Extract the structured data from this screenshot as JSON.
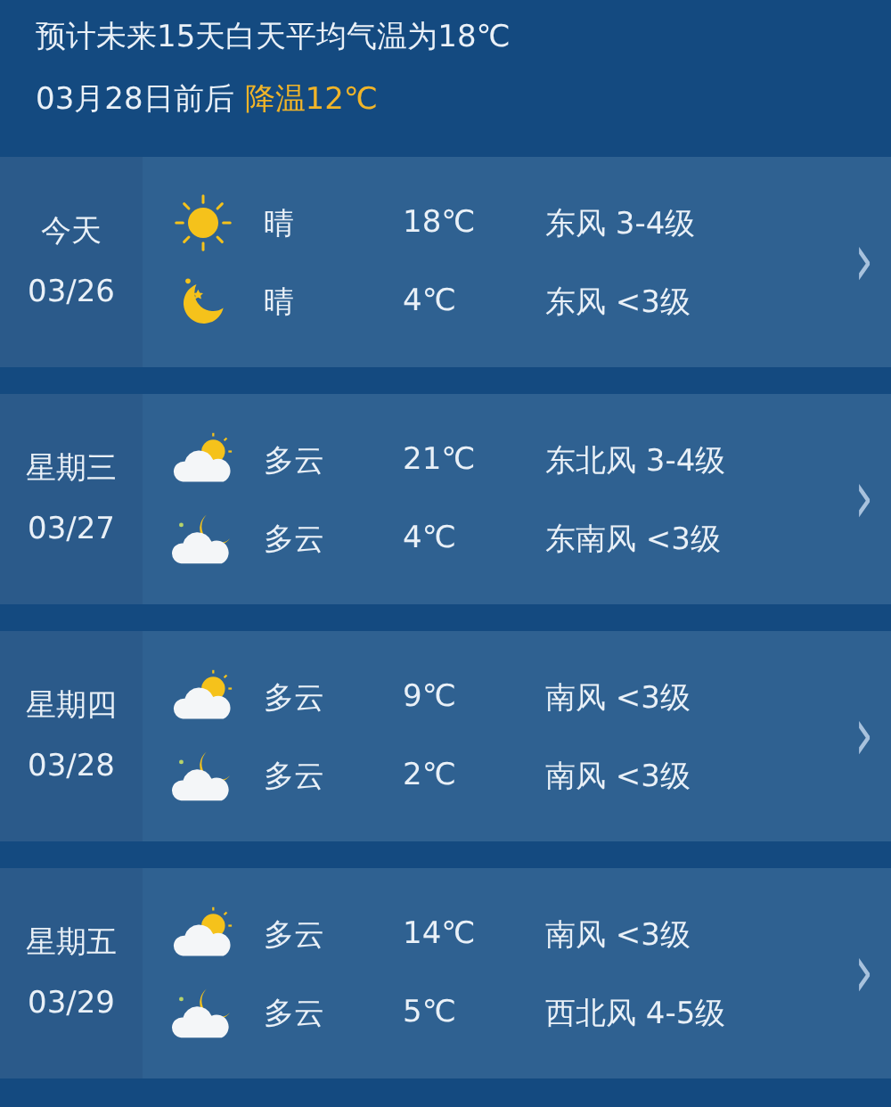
{
  "summary": {
    "line1": "预计未来15天白天平均气温为18℃",
    "line2_prefix": "03月28日前后",
    "line2_highlight": "降温12℃"
  },
  "days": [
    {
      "day": "今天",
      "date": "03/26",
      "chevron": "›",
      "periods": [
        {
          "kind": "sun",
          "condition": "晴",
          "temp": "18℃",
          "wind": "东风 3-4级"
        },
        {
          "kind": "moon",
          "condition": "晴",
          "temp": "4℃",
          "wind": "东风 <3级"
        }
      ]
    },
    {
      "day": "星期三",
      "date": "03/27",
      "chevron": "›",
      "periods": [
        {
          "kind": "cloud-sun",
          "condition": "多云",
          "temp": "21℃",
          "wind": "东北风 3-4级"
        },
        {
          "kind": "cloud-moon",
          "condition": "多云",
          "temp": "4℃",
          "wind": "东南风 <3级"
        }
      ]
    },
    {
      "day": "星期四",
      "date": "03/28",
      "chevron": "›",
      "periods": [
        {
          "kind": "cloud-sun",
          "condition": "多云",
          "temp": "9℃",
          "wind": "南风 <3级"
        },
        {
          "kind": "cloud-moon",
          "condition": "多云",
          "temp": "2℃",
          "wind": "南风 <3级"
        }
      ]
    },
    {
      "day": "星期五",
      "date": "03/29",
      "chevron": "›",
      "periods": [
        {
          "kind": "cloud-sun",
          "condition": "多云",
          "temp": "14℃",
          "wind": "南风 <3级"
        },
        {
          "kind": "cloud-moon",
          "condition": "多云",
          "temp": "5℃",
          "wind": "西北风 4-5级"
        }
      ]
    }
  ]
}
